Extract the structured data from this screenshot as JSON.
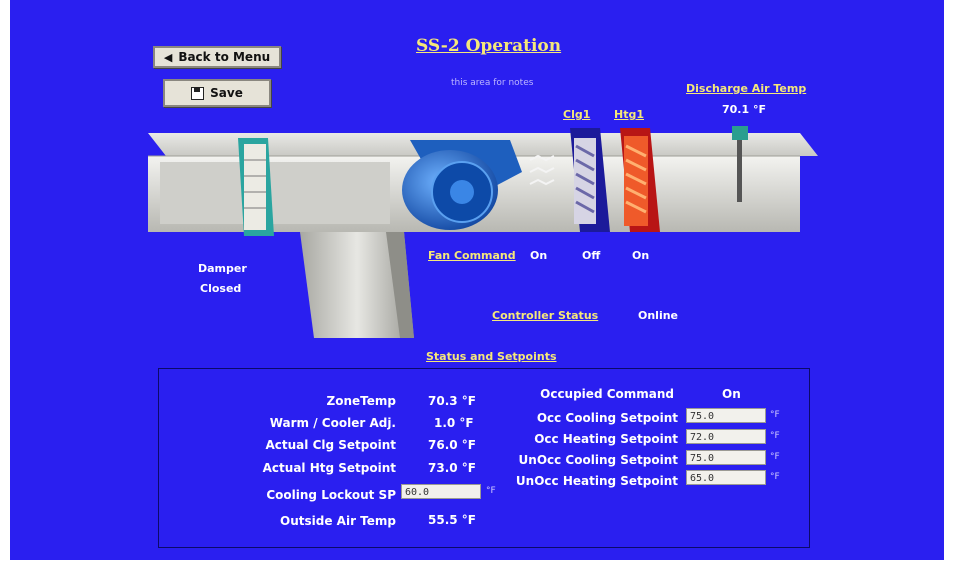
{
  "title": "SS-2 Operation",
  "notes_text": "this area for notes",
  "buttons": {
    "back": "Back to Menu",
    "save": "Save"
  },
  "discharge": {
    "label": "Discharge Air Temp",
    "value": "70.1 °F"
  },
  "coil_labels": {
    "clg": "Clg1",
    "htg": "Htg1"
  },
  "damper": {
    "label": "Damper",
    "state": "Closed"
  },
  "fan": {
    "label": "Fan Command",
    "fan_state": "On",
    "clg_state": "Off",
    "htg_state": "On"
  },
  "controller": {
    "label": "Controller Status",
    "value": "Online"
  },
  "status_header": "Status and Setpoints",
  "left_rows": [
    {
      "label": "ZoneTemp",
      "value": "70.3 °F"
    },
    {
      "label": "Warm / Cooler Adj.",
      "value": "1.0 °F"
    },
    {
      "label": "Actual Clg Setpoint",
      "value": "76.0 °F"
    },
    {
      "label": "Actual Htg Setpoint",
      "value": "73.0 °F"
    },
    {
      "label": "Cooling Lockout SP",
      "value": "60.0"
    },
    {
      "label": "Outside Air Temp",
      "value": "55.5 °F"
    }
  ],
  "right_rows": [
    {
      "label": "Occupied Command",
      "value": "On"
    },
    {
      "label": "Occ Cooling Setpoint",
      "value": "75.0"
    },
    {
      "label": "Occ Heating Setpoint",
      "value": "72.0"
    },
    {
      "label": "UnOcc Cooling Setpoint",
      "value": "75.0"
    },
    {
      "label": "UnOcc Heating Setpoint",
      "value": "65.0"
    }
  ],
  "units": {
    "deg_f": "°F"
  },
  "colors": {
    "background": "#2a1ff0",
    "link_yellow": "#f5e87a",
    "cooling_coil": "#1c1a9a",
    "heating_coil": "#e8421e",
    "fan_blue": "#1e6fd0"
  }
}
